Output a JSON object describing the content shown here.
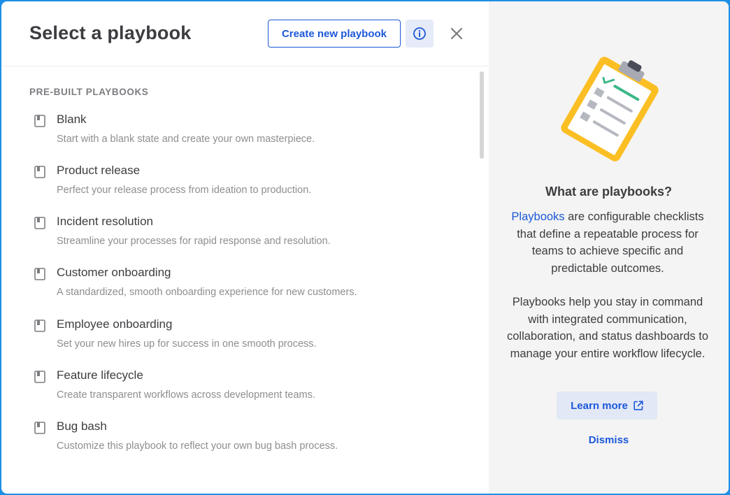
{
  "header": {
    "title": "Select a playbook",
    "create_label": "Create new playbook"
  },
  "list": {
    "section_label": "PRE-BUILT PLAYBOOKS",
    "items": [
      {
        "name": "Blank",
        "desc": "Start with a blank state and create your own masterpiece."
      },
      {
        "name": "Product release",
        "desc": "Perfect your release process from ideation to production."
      },
      {
        "name": "Incident resolution",
        "desc": "Streamline your processes for rapid response and resolution."
      },
      {
        "name": "Customer onboarding",
        "desc": "A standardized, smooth onboarding experience for new customers."
      },
      {
        "name": "Employee onboarding",
        "desc": "Set your new hires up for success in one smooth process."
      },
      {
        "name": "Feature lifecycle",
        "desc": "Create transparent workflows across development teams."
      },
      {
        "name": "Bug bash",
        "desc": "Customize this playbook to reflect your own bug bash process."
      }
    ]
  },
  "sidebar": {
    "title": "What are playbooks?",
    "p1_link": "Playbooks",
    "p1_rest": " are configurable checklists that define a repeatable process for teams to achieve specific and predictable outcomes.",
    "p2": "Playbooks help you stay in command with integrated communication, collaboration, and status dashboards to manage your entire workflow lifecycle.",
    "learn_more_label": "Learn more",
    "dismiss_label": "Dismiss"
  },
  "icons": {
    "item": "playbook-book-icon",
    "info": "info-circle-icon",
    "close": "close-icon",
    "external": "external-link-icon"
  },
  "colors": {
    "accent": "#1c58d9",
    "border_blue": "#1e8fe6",
    "clipboard_yellow": "#fbbf24",
    "check_green": "#3db887"
  }
}
